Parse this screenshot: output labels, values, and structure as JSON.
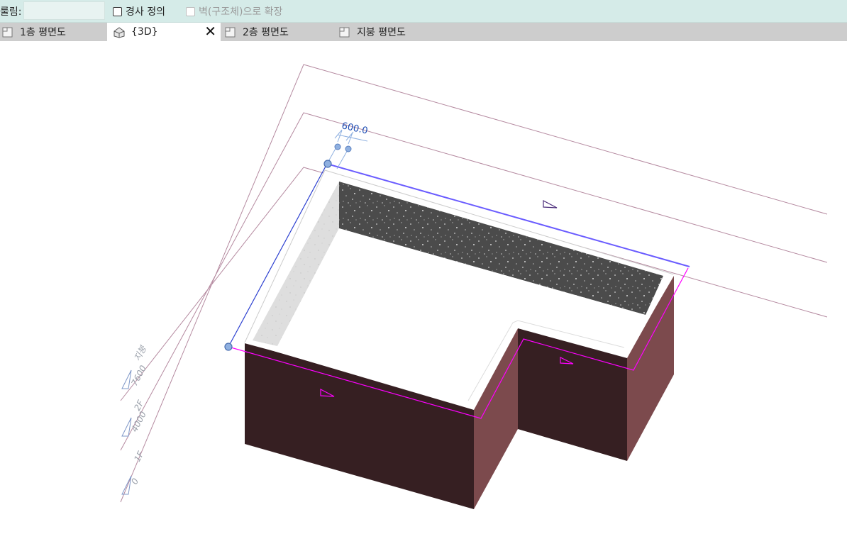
{
  "options_bar": {
    "label": "룰림:",
    "slope_checkbox": {
      "label": "경사 정의",
      "checked": false
    },
    "extend_checkbox": {
      "label": "벽(구조체)으로 확장",
      "checked": false,
      "enabled": false
    }
  },
  "tabs": [
    {
      "label": "1층 평면도",
      "icon": "floor-plan-icon",
      "active": false
    },
    {
      "label": "{3D}",
      "icon": "house-3d-icon",
      "active": true,
      "closable": true
    },
    {
      "label": "2층 평면도",
      "icon": "floor-plan-icon",
      "active": false
    },
    {
      "label": "지붕 평면도",
      "icon": "floor-plan-icon",
      "active": false
    }
  ],
  "viewport": {
    "dimension_label": "600.0",
    "levels": [
      {
        "name": "지붕",
        "elevation": "7600"
      },
      {
        "name": "2F",
        "elevation": "4000"
      },
      {
        "name": "1F",
        "elevation": "0"
      }
    ],
    "colors": {
      "wall_dark": "#361f22",
      "wall_side": "#7c4a4d",
      "sketch_line": "#ff00ff",
      "selected_line": "#6a5cff",
      "level_line": "#b58aa0",
      "dimension": "#3a6fd1",
      "grip": "#8fb0e0"
    }
  }
}
